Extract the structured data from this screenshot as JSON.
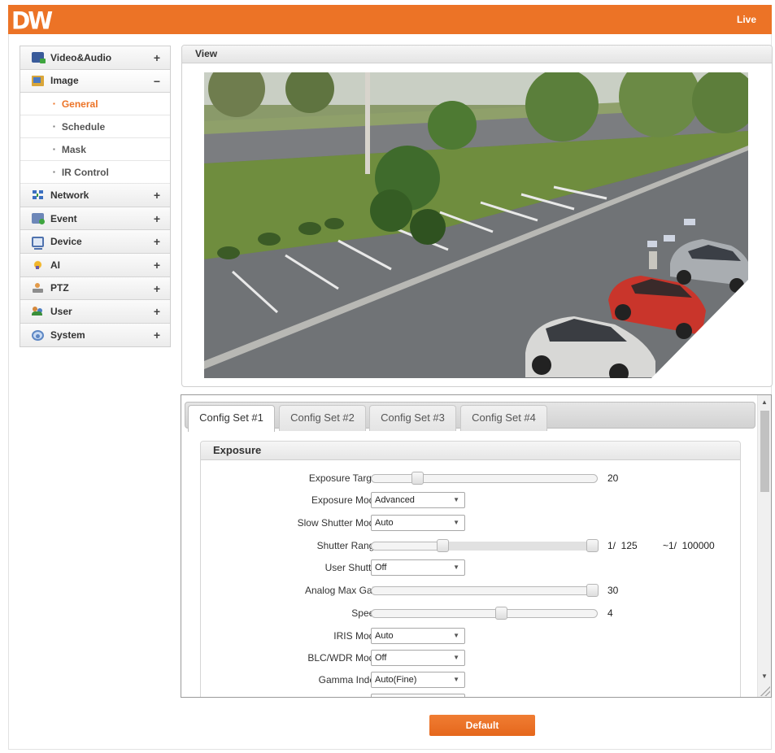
{
  "header": {
    "logo_text": "DW",
    "live_label": "Live",
    "accent_color": "#ec7326"
  },
  "sidebar": {
    "items": [
      {
        "label": "Video&Audio",
        "icon": "video-audio-icon",
        "toggle": "+"
      },
      {
        "label": "Image",
        "icon": "image-icon",
        "toggle": "−"
      },
      {
        "label": "Network",
        "icon": "network-icon",
        "toggle": "+"
      },
      {
        "label": "Event",
        "icon": "event-icon",
        "toggle": "+"
      },
      {
        "label": "Device",
        "icon": "device-icon",
        "toggle": "+"
      },
      {
        "label": "AI",
        "icon": "ai-icon",
        "toggle": "+"
      },
      {
        "label": "PTZ",
        "icon": "ptz-icon",
        "toggle": "+"
      },
      {
        "label": "User",
        "icon": "user-icon",
        "toggle": "+"
      },
      {
        "label": "System",
        "icon": "system-icon",
        "toggle": "+"
      }
    ],
    "image_submenu": [
      {
        "label": "General",
        "active": true
      },
      {
        "label": "Schedule"
      },
      {
        "label": "Mask"
      },
      {
        "label": "IR Control"
      }
    ]
  },
  "view": {
    "title": "View"
  },
  "config": {
    "tabs": [
      "Config Set #1",
      "Config Set #2",
      "Config Set #3",
      "Config Set #4"
    ],
    "active_tab": "Config Set #1",
    "section_title": "Exposure",
    "fields": {
      "exposure_target": {
        "label": "Exposure Target",
        "value": "20",
        "level": 0.19
      },
      "exposure_mode": {
        "label": "Exposure Mode",
        "value": "Advanced"
      },
      "slow_shutter_mode": {
        "label": "Slow Shutter Mode",
        "value": "Auto"
      },
      "shutter_range": {
        "label": "Shutter Range",
        "min_text": "1/  125",
        "max_text": "~1/  100000",
        "low": 0.31,
        "high": 1.0
      },
      "user_shutter": {
        "label": "User Shutter",
        "value": "Off"
      },
      "analog_max_gain": {
        "label": "Analog Max Gain",
        "value": "30",
        "level": 1.0
      },
      "speed": {
        "label": "Speed",
        "value": "4",
        "level": 0.58
      },
      "iris_mode": {
        "label": "IRIS Mode",
        "value": "Auto"
      },
      "blc_wdr_mode": {
        "label": "BLC/WDR Mode",
        "value": "Off"
      },
      "gamma_index": {
        "label": "Gamma Index",
        "value": "Auto(Fine)"
      }
    }
  },
  "footer": {
    "default_label": "Default"
  }
}
